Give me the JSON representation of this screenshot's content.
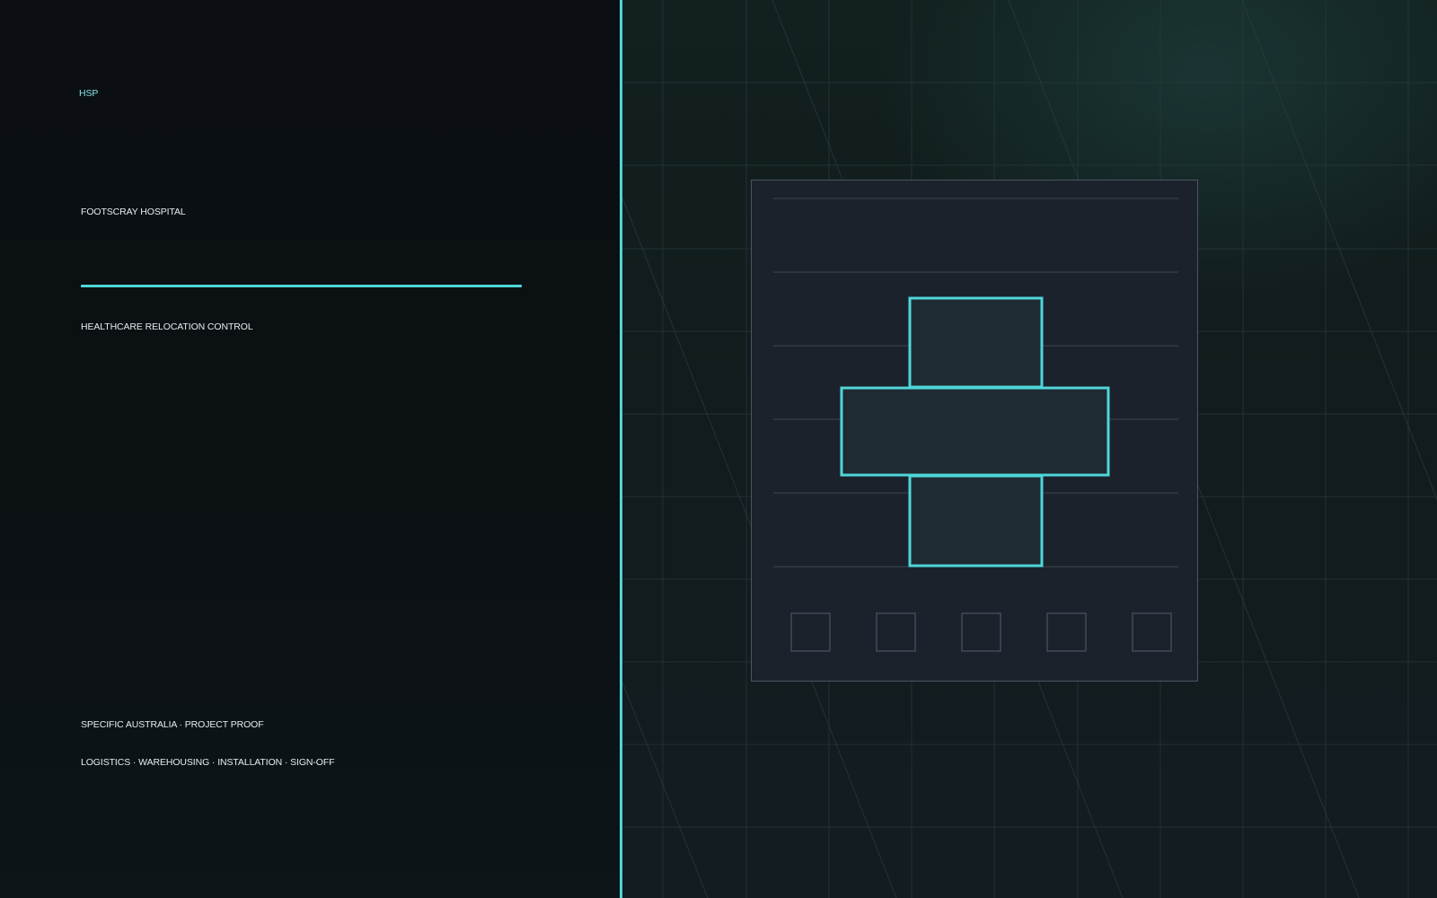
{
  "brand": {
    "label": "HSP"
  },
  "hero": {
    "title": "FOOTSCRAY HOSPITAL",
    "subtitle": "HEALTHCARE RELOCATION CONTROL",
    "proof_line": "SPECIFIC AUSTRALIA · PROJECT PROOF",
    "services_line": "LOGISTICS · WAREHOUSING · INSTALLATION · SIGN-OFF"
  },
  "colors": {
    "accent": "#4fd6d8",
    "brand_text": "#7fe3e4",
    "text": "#e6ecef",
    "card_fill": "#1b222c",
    "card_border": "#4b5561",
    "grid": "#2a3b3c"
  },
  "illustration": {
    "icon": "medical-cross-icon",
    "tiles": [
      "tile",
      "tile",
      "tile",
      "tile",
      "tile"
    ]
  }
}
